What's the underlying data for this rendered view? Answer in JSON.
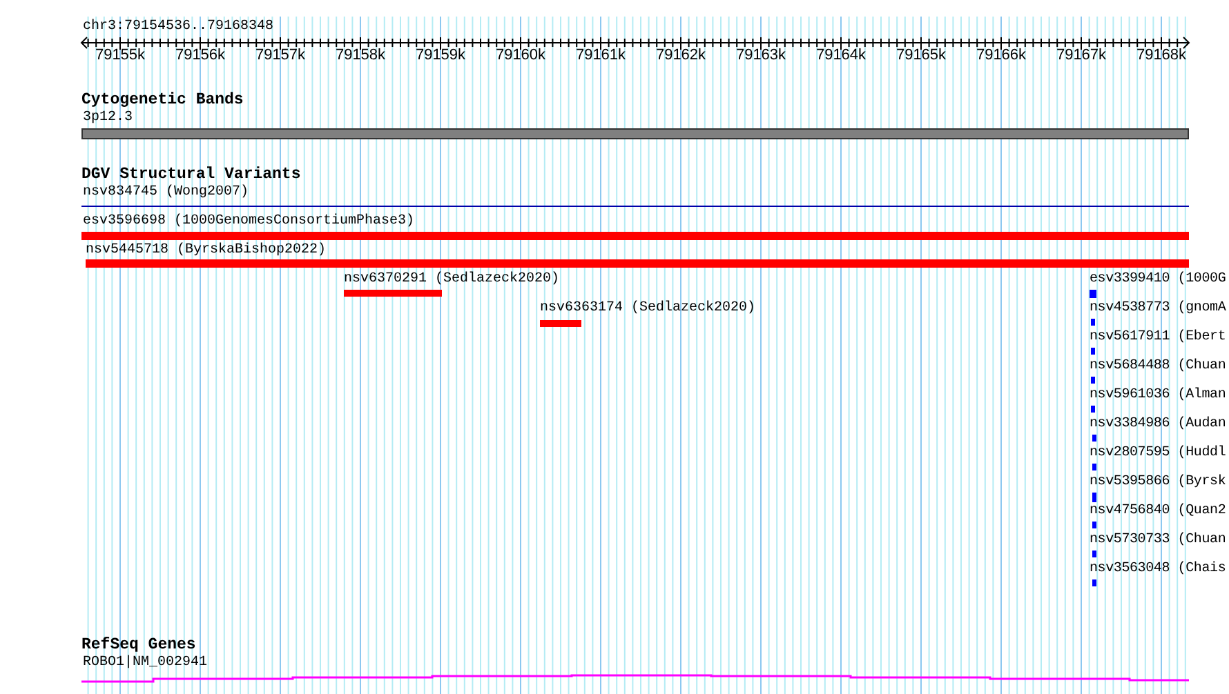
{
  "location": "chr3:79154536..79168348",
  "ruler": {
    "ticks": [
      "79155k",
      "79156k",
      "79157k",
      "79158k",
      "79159k",
      "79160k",
      "79161k",
      "79162k",
      "79163k",
      "79164k",
      "79165k",
      "79166k",
      "79167k",
      "79168k"
    ]
  },
  "tracks": [
    {
      "kind": "bands",
      "title": "Cytogenetic Bands",
      "features": [
        {
          "label": "3p12.3",
          "color": "#808080"
        }
      ]
    },
    {
      "kind": "variants",
      "title": "DGV Structural Variants",
      "features": [
        {
          "label": "nsv834745 (Wong2007)",
          "color": "#0000aa"
        },
        {
          "label": "esv3596698 (1000GenomesConsortiumPhase3)",
          "color": "#ff0000"
        },
        {
          "label": "nsv5445718 (ByrskaBishop2022)",
          "color": "#ff0000"
        },
        {
          "label": "nsv6370291 (Sedlazeck2020)",
          "color": "#ff0000"
        },
        {
          "label": "nsv6363174 (Sedlazeck2020)",
          "color": "#ff0000"
        },
        {
          "label": "esv3399410 (1000G",
          "color": "#0000ff"
        },
        {
          "label": "nsv4538773 (gnomA",
          "color": "#0000ff"
        },
        {
          "label": "nsv5617911 (Ebert",
          "color": "#0000ff"
        },
        {
          "label": "nsv5684488 (Chuan",
          "color": "#0000ff"
        },
        {
          "label": "nsv5961036 (Alman",
          "color": "#0000ff"
        },
        {
          "label": "nsv3384986 (Audan",
          "color": "#0000ff"
        },
        {
          "label": "nsv2807595 (Huddl",
          "color": "#0000ff"
        },
        {
          "label": "nsv5395866 (Byrsk",
          "color": "#0000ff"
        },
        {
          "label": "nsv4756840 (Quan2",
          "color": "#0000ff"
        },
        {
          "label": "nsv5730733 (Chuan",
          "color": "#0000ff"
        },
        {
          "label": "nsv3563048 (Chais",
          "color": "#0000ff"
        }
      ]
    },
    {
      "kind": "genes",
      "title": "RefSeq Genes",
      "features": [
        {
          "label": "ROBO1|NM_002941",
          "color": "#ff00ff"
        }
      ]
    }
  ]
}
